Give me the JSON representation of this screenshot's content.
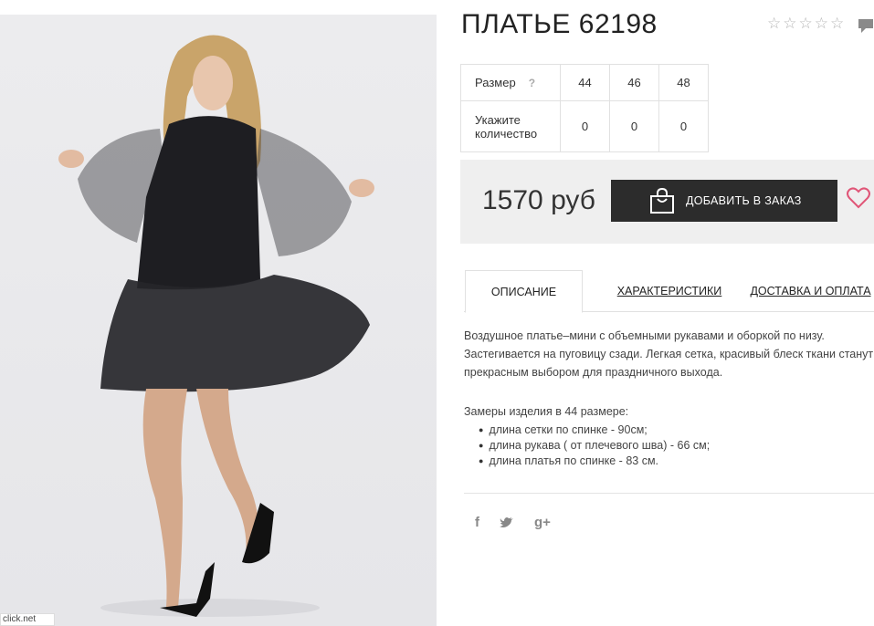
{
  "product": {
    "title": "ПЛАТЬЕ 62198",
    "rating_stars": 0,
    "rating_max": 5,
    "watermark": "click.net"
  },
  "sizes": {
    "row_label": "Размер",
    "help": "?",
    "values": [
      "44",
      "46",
      "48"
    ],
    "qty_label": "Укажите количество",
    "quantities": [
      "0",
      "0",
      "0"
    ]
  },
  "buy": {
    "price": "1570 руб",
    "add_label": "ДОБАВИТЬ В ЗАКАЗ"
  },
  "tabs": [
    "ОПИСАНИЕ",
    "ХАРАКТЕРИСТИКИ",
    "ДОСТАВКА И ОПЛАТА"
  ],
  "description": {
    "text": "Воздушное платье–мини с объемными рукавами и оборкой по низу. Застегивается на пуговицу сзади. Легкая сетка, красивый блеск ткани станут прекрасным выбором для праздничного выхода.",
    "measures_title": "Замеры изделия в 44 размере:",
    "measures": [
      "длина сетки по спинке - 90см;",
      "длина рукава ( от плечевого шва) - 66 см;",
      "длина платья по спинке - 83 см."
    ]
  },
  "social": {
    "facebook": "f",
    "google": "g+"
  },
  "colors": {
    "button_bg": "#2c2c2c",
    "wishlist": "#e05577",
    "buybox_bg": "#efefef"
  }
}
